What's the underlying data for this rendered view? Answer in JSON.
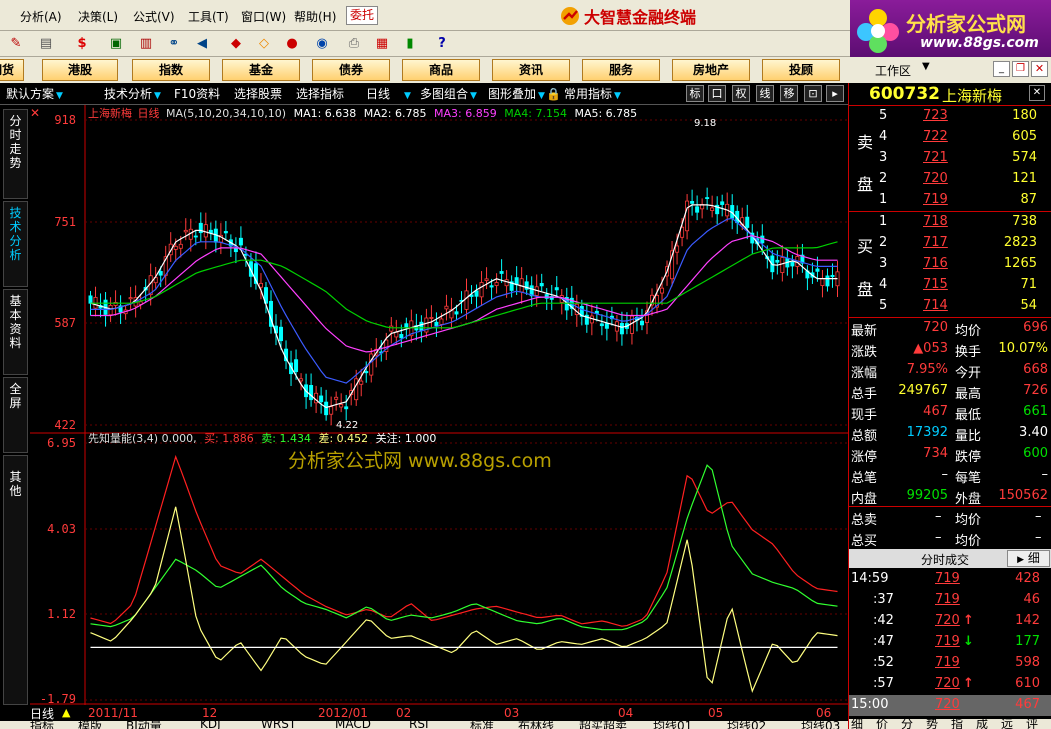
{
  "menu": {
    "items": [
      "分析(A)",
      "决策(L)",
      "公式(V)",
      "工具(T)",
      "窗口(W)",
      "帮助(H)"
    ],
    "entrust": "委托",
    "brand": "大智慧金融终端"
  },
  "logo": {
    "cn": "分析家公式网",
    "url": "www.88gs.com"
  },
  "market_tabs": [
    "期货",
    "港股",
    "指数",
    "基金",
    "债券",
    "商品",
    "资讯",
    "服务",
    "房地产",
    "投顾"
  ],
  "workspace": "工作区",
  "chart_toolbar": {
    "items": [
      "默认方案",
      "技术分析",
      "F10资料",
      "选择股票",
      "选择指标",
      "日线",
      "多图组合",
      "图形叠加",
      "常用指标"
    ],
    "right_buttons": [
      "标",
      "口",
      "权",
      "线",
      "移"
    ]
  },
  "side_tabs": [
    "分时走势",
    "技术分析",
    "基本资料",
    "全屏",
    "其他"
  ],
  "upper_panel": {
    "stock_name": "上海新梅",
    "period": "日线",
    "ma_params": "MA(5,10,20,34,10,10)",
    "ma1": "MA1: 6.638",
    "ma2": "MA2: 6.785",
    "ma3": "MA3: 6.859",
    "ma4": "MA4: 7.154",
    "ma5": "MA5: 6.785",
    "y_ticks": [
      "918",
      "751",
      "587",
      "422"
    ],
    "high_label": "9.18",
    "low_label": "4.22"
  },
  "lower_panel": {
    "title": "先知量能(3,4) 0.000,",
    "buy": "买: 1.886",
    "sell": "卖: 1.434",
    "diff": "差: 0.452",
    "watch": "关注: 1.000",
    "y_ticks": [
      "6.95",
      "4.03",
      "1.12",
      "-1.79"
    ],
    "watermark": "分析家公式网 www.88gs.com"
  },
  "date_axis": {
    "period_label": "日线",
    "labels": [
      "2011/11",
      "12",
      "2012/01",
      "02",
      "03",
      "04",
      "05",
      "06"
    ]
  },
  "bottom_tabs": [
    "指标",
    "模版",
    "BJ动量",
    "KDJ",
    "WRST",
    "MACD",
    "RSI",
    "标准",
    "布林线",
    "超买超卖",
    "均线01",
    "均线02",
    "均线03",
    "均线04",
    "其他"
  ],
  "quote": {
    "code": "600732",
    "name": "上海新梅",
    "sell_label": [
      "卖",
      "盘"
    ],
    "buy_label": [
      "买",
      "盘"
    ],
    "asks": [
      {
        "lvl": "5",
        "price": "723",
        "vol": "180"
      },
      {
        "lvl": "4",
        "price": "722",
        "vol": "605"
      },
      {
        "lvl": "3",
        "price": "721",
        "vol": "574"
      },
      {
        "lvl": "2",
        "price": "720",
        "vol": "121"
      },
      {
        "lvl": "1",
        "price": "719",
        "vol": "87"
      }
    ],
    "bids": [
      {
        "lvl": "1",
        "price": "718",
        "vol": "738"
      },
      {
        "lvl": "2",
        "price": "717",
        "vol": "2823"
      },
      {
        "lvl": "3",
        "price": "716",
        "vol": "1265"
      },
      {
        "lvl": "4",
        "price": "715",
        "vol": "71"
      },
      {
        "lvl": "5",
        "price": "714",
        "vol": "54"
      }
    ],
    "stats": [
      {
        "k1": "最新",
        "v1": "720",
        "c1": "red",
        "k2": "均价",
        "v2": "696",
        "c2": "red"
      },
      {
        "k1": "涨跌",
        "v1": "▲053",
        "c1": "red",
        "k2": "换手",
        "v2": "10.07%",
        "c2": "yellow"
      },
      {
        "k1": "涨幅",
        "v1": "7.95%",
        "c1": "red",
        "k2": "今开",
        "v2": "668",
        "c2": "red"
      },
      {
        "k1": "总手",
        "v1": "249767",
        "c1": "yellow",
        "k2": "最高",
        "v2": "726",
        "c2": "red"
      },
      {
        "k1": "现手",
        "v1": "467",
        "c1": "red",
        "k2": "最低",
        "v2": "661",
        "c2": "green"
      },
      {
        "k1": "总额",
        "v1": "17392",
        "c1": "cyan",
        "k2": "量比",
        "v2": "3.40",
        "c2": "white"
      },
      {
        "k1": "涨停",
        "v1": "734",
        "c1": "red",
        "k2": "跌停",
        "v2": "600",
        "c2": "green"
      },
      {
        "k1": "总笔",
        "v1": "–",
        "c1": "white",
        "k2": "每笔",
        "v2": "–",
        "c2": "white"
      },
      {
        "k1": "内盘",
        "v1": "99205",
        "c1": "green",
        "k2": "外盘",
        "v2": "150562",
        "c2": "red"
      }
    ],
    "total_sell": {
      "k1": "总卖",
      "v1": "–",
      "k2": "均价",
      "v2": "–"
    },
    "total_buy": {
      "k1": "总买",
      "v1": "–",
      "k2": "均价",
      "v2": "–"
    },
    "ticks_header": "分时成交",
    "ticks_btn": "细",
    "ticks": [
      {
        "time": "14:59",
        "price": "719",
        "arrow": "",
        "vol": "428",
        "vc": "red"
      },
      {
        "time": ":37",
        "price": "719",
        "arrow": "",
        "vol": "46",
        "vc": "red"
      },
      {
        "time": ":42",
        "price": "720",
        "arrow": "↑",
        "vol": "142",
        "vc": "red"
      },
      {
        "time": ":47",
        "price": "719",
        "arrow": "↓",
        "vol": "177",
        "vc": "green"
      },
      {
        "time": ":52",
        "price": "719",
        "arrow": "",
        "vol": "598",
        "vc": "red"
      },
      {
        "time": ":57",
        "price": "720",
        "arrow": "↑",
        "vol": "610",
        "vc": "red"
      },
      {
        "time": "15:00",
        "price": "720",
        "arrow": "",
        "vol": "467",
        "vc": "red"
      }
    ],
    "bottom_tabs": [
      "细",
      "价",
      "分",
      "势",
      "指",
      "成",
      "远",
      "评"
    ]
  },
  "colors": {
    "up": "#ff3b3b",
    "down": "#00ffff",
    "ma1": "#ffffff",
    "ma2": "#3b5bff",
    "ma3": "#ff40ff",
    "ma4": "#00d000",
    "buy_line": "#ff2020",
    "sell_line": "#30ff30",
    "diff_line": "#ffff80"
  },
  "chart_data": [
    {
      "type": "candlestick",
      "title": "上海新梅 日线",
      "ylim": [
        4.22,
        9.18
      ],
      "x_labels": [
        "2011/11",
        "12",
        "2012/01",
        "02",
        "03",
        "04",
        "05",
        "06"
      ],
      "series": [
        {
          "name": "MA1",
          "values": [
            6.2,
            6.1,
            6.2,
            6.6,
            7.2,
            7.4,
            7.3,
            7.1,
            6.4,
            5.4,
            4.8,
            4.5,
            4.6,
            5.2,
            5.7,
            5.8,
            5.9,
            6.1,
            6.4,
            6.6,
            6.5,
            6.4,
            6.3,
            6.0,
            5.9,
            5.8,
            6.0,
            6.7,
            7.8,
            7.8,
            7.7,
            7.3,
            6.8,
            6.9,
            6.6,
            6.6
          ]
        },
        {
          "name": "MA2",
          "values": [
            6.1,
            6.1,
            6.2,
            6.4,
            6.9,
            7.2,
            7.2,
            7.1,
            6.8,
            6.1,
            5.5,
            5.0,
            4.9,
            5.2,
            5.5,
            5.7,
            5.8,
            5.9,
            6.1,
            6.3,
            6.4,
            6.3,
            6.3,
            6.1,
            6.0,
            5.9,
            6.0,
            6.3,
            7.1,
            7.4,
            7.6,
            7.3,
            7.0,
            6.9,
            6.8,
            6.8
          ]
        },
        {
          "name": "MA3",
          "values": [
            6.0,
            6.0,
            6.1,
            6.3,
            6.6,
            6.9,
            7.1,
            7.1,
            7.0,
            6.6,
            6.2,
            5.8,
            5.5,
            5.4,
            5.5,
            5.6,
            5.7,
            5.8,
            5.9,
            6.1,
            6.2,
            6.3,
            6.3,
            6.2,
            6.1,
            6.0,
            6.0,
            6.1,
            6.5,
            6.9,
            7.2,
            7.3,
            7.2,
            7.0,
            6.9,
            6.9
          ]
        },
        {
          "name": "MA4",
          "values": [
            6.2,
            6.2,
            6.2,
            6.3,
            6.5,
            6.7,
            6.8,
            6.9,
            6.9,
            6.8,
            6.6,
            6.4,
            6.1,
            5.9,
            5.8,
            5.8,
            5.8,
            5.8,
            5.9,
            6.0,
            6.1,
            6.2,
            6.2,
            6.2,
            6.2,
            6.2,
            6.2,
            6.2,
            6.4,
            6.6,
            6.8,
            7.0,
            7.1,
            7.1,
            7.1,
            7.2
          ]
        }
      ]
    },
    {
      "type": "line",
      "title": "先知量能(3,4)",
      "ylim": [
        -1.79,
        6.95
      ],
      "series": [
        {
          "name": "买",
          "values": [
            1.0,
            0.8,
            1.5,
            4.0,
            6.5,
            4.5,
            2.8,
            2.5,
            3.0,
            2.4,
            1.8,
            1.4,
            1.1,
            1.3,
            1.0,
            1.5,
            0.9,
            1.1,
            1.3,
            1.4,
            1.2,
            1.0,
            1.1,
            0.8,
            0.9,
            0.7,
            1.0,
            2.5,
            6.0,
            4.5,
            5.0,
            4.0,
            3.5,
            2.5,
            2.0,
            1.9
          ]
        },
        {
          "name": "卖",
          "values": [
            0.8,
            0.7,
            1.0,
            2.0,
            3.0,
            2.6,
            2.0,
            2.4,
            2.8,
            2.0,
            1.5,
            1.3,
            1.0,
            1.4,
            0.9,
            1.1,
            1.0,
            1.2,
            1.5,
            1.2,
            0.9,
            0.8,
            1.0,
            0.7,
            0.6,
            0.6,
            0.9,
            2.0,
            4.5,
            6.4,
            3.5,
            2.5,
            2.2,
            2.0,
            1.5,
            1.4
          ]
        },
        {
          "name": "差",
          "values": [
            0.5,
            0.2,
            1.0,
            2.0,
            4.8,
            0.8,
            -0.5,
            0.2,
            -0.8,
            0.4,
            -0.3,
            -0.6,
            0.2,
            1.0,
            0.3,
            0.4,
            0.1,
            -0.2,
            0.6,
            0.1,
            0.3,
            -0.1,
            0.2,
            0.1,
            0.3,
            0.0,
            0.3,
            0.8,
            3.8,
            -1.6,
            1.5,
            -1.5,
            0.2,
            -0.6,
            0.5,
            0.4
          ]
        },
        {
          "name": "关注",
          "values": [
            0.0,
            0.0,
            0.0,
            0.0,
            0.0,
            0.0,
            0.0,
            0.0,
            0.0,
            0.0,
            0.0,
            0.0,
            0.0,
            0.0,
            0.0,
            0.0,
            0.0,
            0.0,
            0.0,
            0.0,
            0.0,
            0.0,
            0.0,
            0.0,
            0.0,
            0.0,
            0.0,
            0.0,
            0.0,
            0.0,
            0.0,
            0.0,
            0.0,
            0.0,
            0.0,
            0.0
          ]
        }
      ]
    }
  ]
}
